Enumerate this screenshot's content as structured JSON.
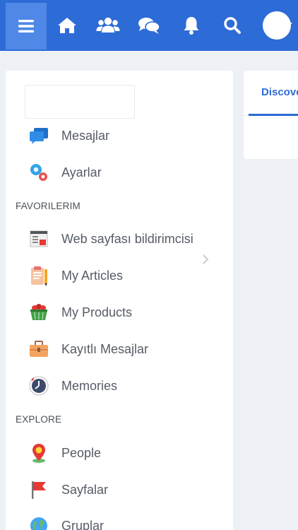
{
  "topbar": {
    "icons": [
      "hamburger-menu-icon",
      "home-icon",
      "friends-icon",
      "chat-bubbles-icon",
      "bell-icon",
      "search-icon",
      "avatar"
    ]
  },
  "sidebar": {
    "items_top": [
      {
        "label": "Mesajlar",
        "icon": "chat-bubbles-icon"
      },
      {
        "label": "Ayarlar",
        "icon": "gears-icon"
      }
    ],
    "section_favorites": "FAVORILERIM",
    "favorites": [
      {
        "label": "Web sayfası bildirimcisi",
        "icon": "webpage-notifier-icon"
      },
      {
        "label": "My Articles",
        "icon": "clipboard-icon"
      },
      {
        "label": "My Products",
        "icon": "basket-icon"
      },
      {
        "label": "Kayıtlı Mesajlar",
        "icon": "briefcase-icon"
      },
      {
        "label": "Memories",
        "icon": "clock-icon"
      }
    ],
    "section_explore": "EXPLORE",
    "explore": [
      {
        "label": "People",
        "icon": "person-pin-icon"
      },
      {
        "label": "Sayfalar",
        "icon": "flag-icon"
      },
      {
        "label": "Gruplar",
        "icon": "globe-icon"
      }
    ]
  },
  "panel": {
    "tab_label": "Discover"
  },
  "colors": {
    "brand": "#2d6bd6",
    "active_menu": "#4f88e6",
    "background": "#edf1f5",
    "text": "#555b66"
  }
}
